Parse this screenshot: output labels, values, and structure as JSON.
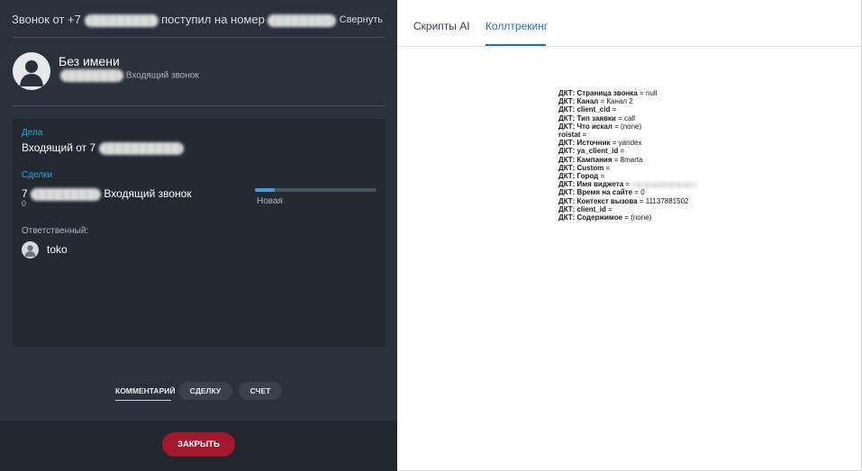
{
  "left_panel": {
    "header": {
      "prefix": "Звонок от +7",
      "middle": "поступил на номер",
      "collapse_label": "Свернуть"
    },
    "contact": {
      "name": "Без имени",
      "subtitle": "Входящий звонок"
    },
    "tasks": {
      "title": "Дела",
      "item_prefix": "Входящий от 7"
    },
    "deals": {
      "title": "Сделки",
      "item_prefix": "7",
      "item_suffix": "Входящий звонок",
      "item_number": "0",
      "progress": 0.16,
      "stage": "Новая"
    },
    "responsible": {
      "label": "Ответственный:",
      "name": "toko"
    },
    "bottom_tabs": {
      "comment": "КОММЕНТАРИЙ",
      "deal": "СДЕЛКУ",
      "invoice": "СЧЕТ"
    },
    "close_button": "ЗАКРЫТЬ",
    "colors": {
      "panel": "#2b313b",
      "accent_blue": "#2fa6dd",
      "close_red": "#a3182a"
    }
  },
  "right_panel": {
    "tabs": [
      {
        "label": "Скрипты AI",
        "active": false
      },
      {
        "label": "Коллтрекинг",
        "active": true
      }
    ],
    "calltracking": [
      {
        "key": "ДКТ: Страница звонка",
        "value": "null"
      },
      {
        "key": "ДКТ: Канал",
        "value": "Канал 2"
      },
      {
        "key": "ДКТ: client_cid",
        "value": ""
      },
      {
        "key": "ДКТ: Тип заявки",
        "value": "call"
      },
      {
        "key": "ДКТ: Что искал",
        "value": "(none)"
      },
      {
        "key": "roistat",
        "value": ""
      },
      {
        "key": "ДКТ: Источник",
        "value": "yandex"
      },
      {
        "key": "ДКТ: ya_client_id",
        "value": ""
      },
      {
        "key": "ДКТ: Кампания",
        "value": "8marta"
      },
      {
        "key": "ДКТ: Custom",
        "value": ""
      },
      {
        "key": "ДКТ: Город",
        "value": ""
      },
      {
        "key": "ДКТ: Имя виджета",
        "value": ""
      },
      {
        "key": "ДКТ: Время на сайте",
        "value": "0"
      },
      {
        "key": "ДКТ: Контекст вызова",
        "value": "11137881502"
      },
      {
        "key": "ДКТ: client_id",
        "value": ""
      },
      {
        "key": "ДКТ: Содержимое",
        "value": "(none)"
      }
    ],
    "colors": {
      "active_tab": "#1f6fd0"
    }
  }
}
